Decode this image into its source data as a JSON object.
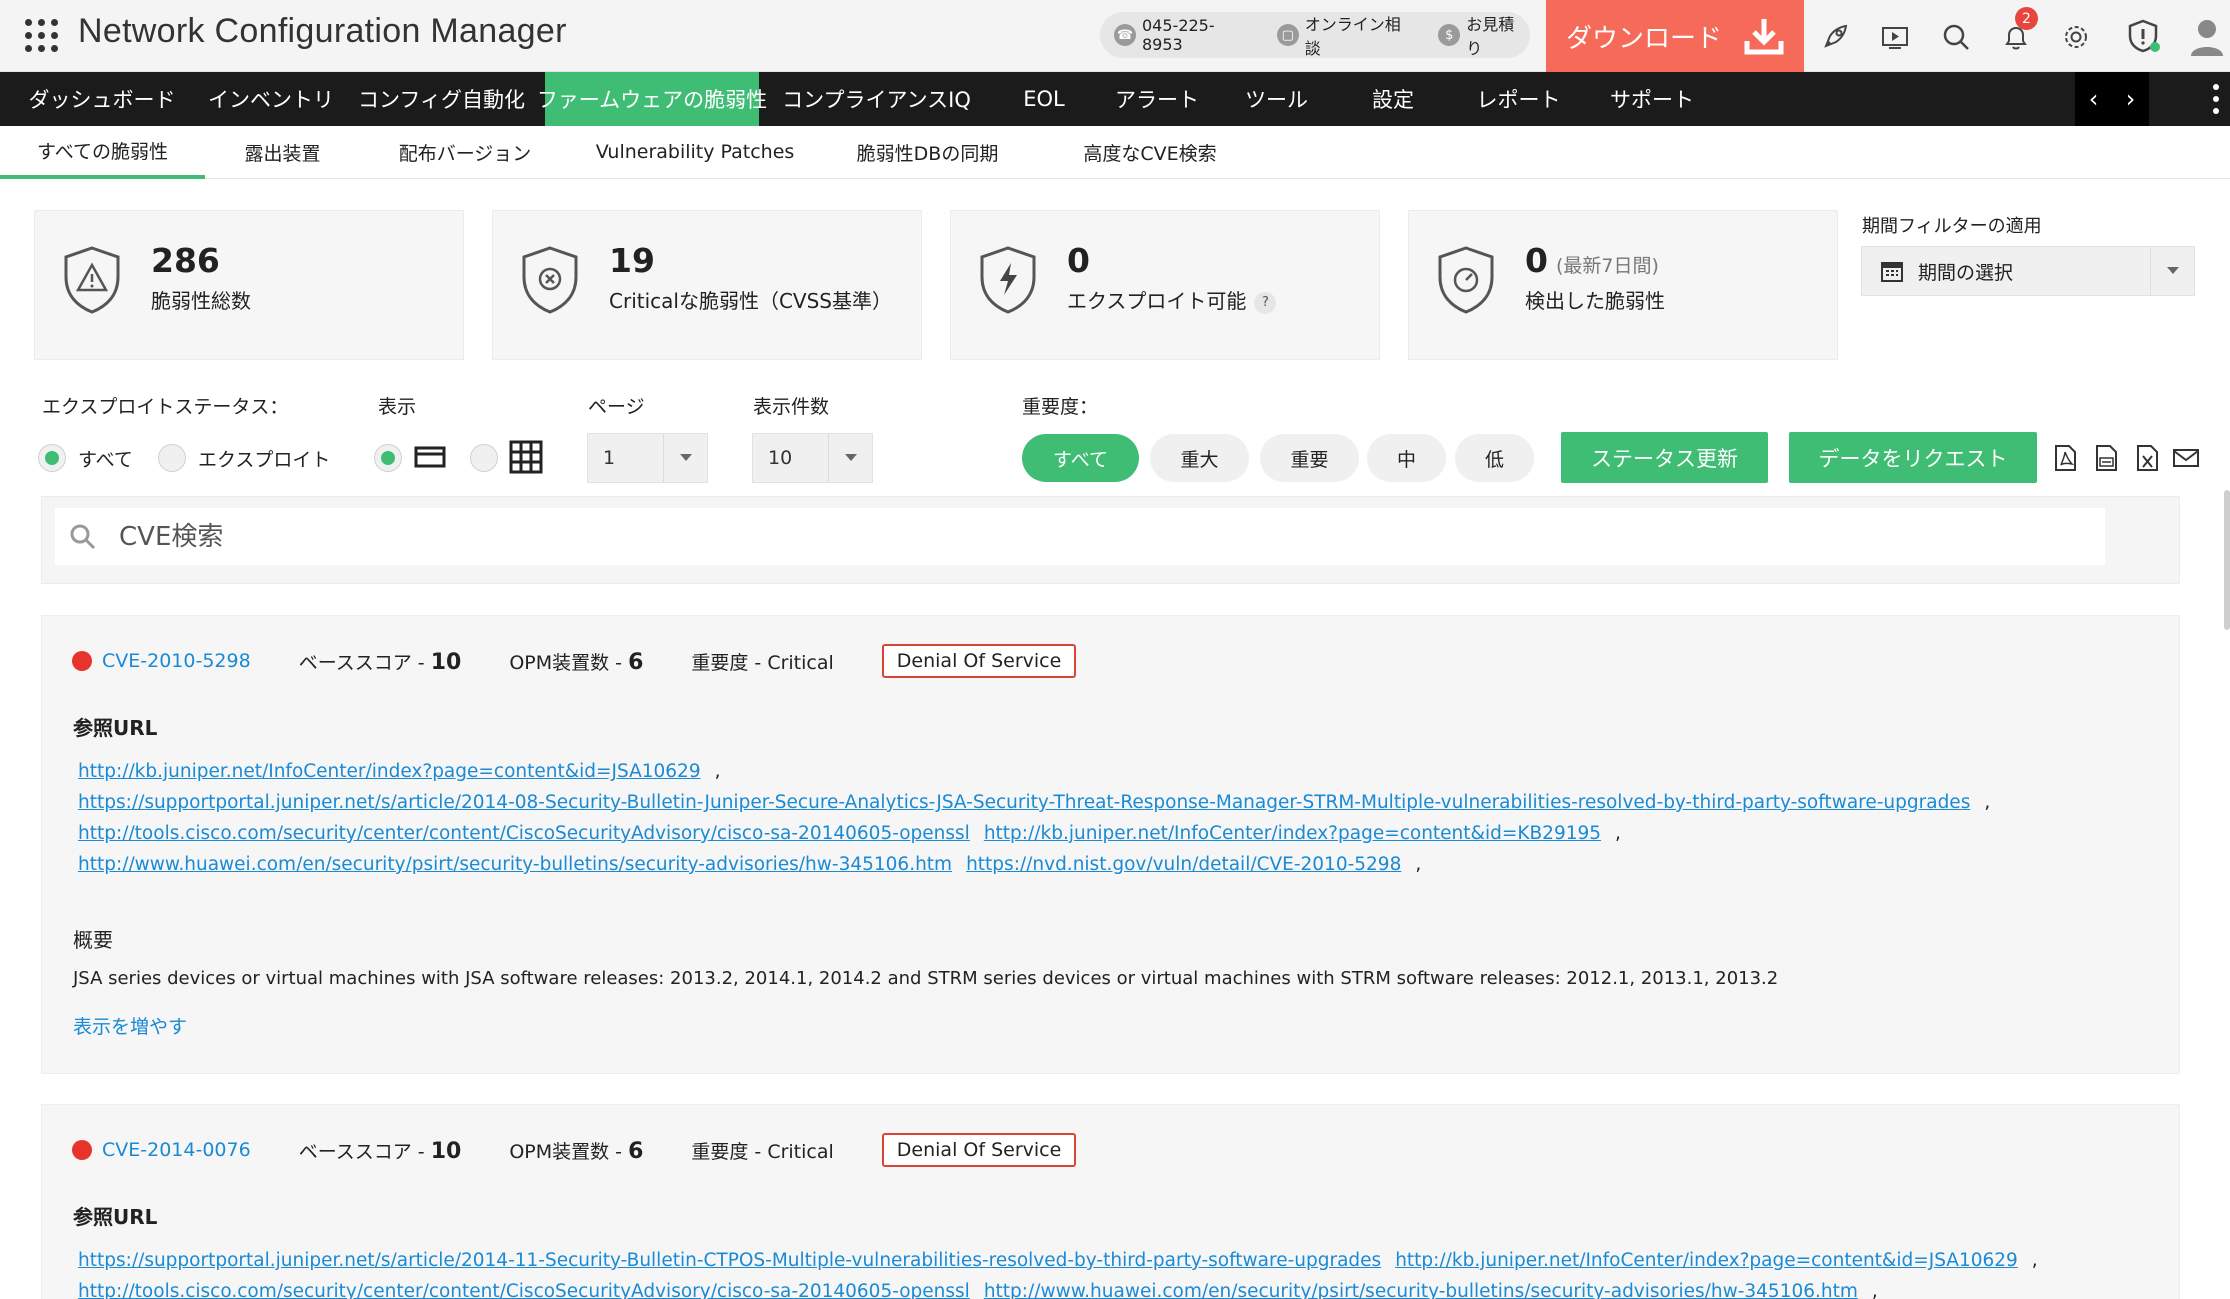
{
  "header": {
    "app_title": "Network Configuration Manager",
    "phone": "045-225-8953",
    "online_consult": "オンライン相談",
    "quote": "お見積り",
    "download_label": "ダウンロード",
    "notification_count": "2"
  },
  "nav": {
    "items": [
      {
        "label": "ダッシュボード"
      },
      {
        "label": "インベントリ"
      },
      {
        "label": "コンフィグ自動化"
      },
      {
        "label": "ファームウェアの脆弱性"
      },
      {
        "label": "コンプライアンスIQ"
      },
      {
        "label": "EOL"
      },
      {
        "label": "アラート"
      },
      {
        "label": "ツール"
      },
      {
        "label": "設定"
      },
      {
        "label": "レポート"
      },
      {
        "label": "サポート"
      }
    ],
    "active_index": 3
  },
  "subnav": {
    "tabs": [
      {
        "label": "すべての脆弱性"
      },
      {
        "label": "露出装置"
      },
      {
        "label": "配布バージョン"
      },
      {
        "label": "Vulnerability Patches"
      },
      {
        "label": "脆弱性DBの同期"
      },
      {
        "label": "高度なCVE検索"
      }
    ],
    "active_index": 0
  },
  "stats": [
    {
      "value": "286",
      "label": "脆弱性総数",
      "icon": "warning-shield-icon"
    },
    {
      "value": "19",
      "label": "Criticalな脆弱性（CVSS基準）",
      "icon": "x-shield-icon"
    },
    {
      "value": "0",
      "label": "エクスプロイト可能",
      "icon": "bolt-shield-icon"
    },
    {
      "value": "0",
      "sublabel": "(最新7日間)",
      "label": "検出した脆弱性",
      "icon": "clock-shield-icon"
    }
  ],
  "period": {
    "label": "期間フィルターの適用",
    "select": "期間の選択"
  },
  "filters": {
    "exploit_label": "エクスプロイトステータス：",
    "exploit_all": "すべて",
    "exploit_only": "エクスプロイト",
    "view_label": "表示",
    "page_label": "ページ",
    "page_value": "1",
    "count_label": "表示件数",
    "count_value": "10",
    "severity_label": "重要度：",
    "severity": [
      {
        "label": "すべて",
        "active": true
      },
      {
        "label": "重大"
      },
      {
        "label": "重要"
      },
      {
        "label": "中"
      },
      {
        "label": "低"
      }
    ],
    "status_update": "ステータス更新",
    "request_data": "データをリクエスト"
  },
  "search": {
    "placeholder": "CVE検索"
  },
  "vulnerabilities": [
    {
      "cve": "CVE-2010-5298",
      "base_score_label": "ベーススコア - ",
      "base_score": "10",
      "opm_label": "OPM装置数 - ",
      "opm_count": "6",
      "severity": "重要度 - Critical",
      "tag": "Denial Of Service",
      "ref_title": "参照URL",
      "urls": [
        "http://kb.juniper.net/InfoCenter/index?page=content&id=JSA10629",
        "https://supportportal.juniper.net/s/article/2014-08-Security-Bulletin-Juniper-Secure-Analytics-JSA-Security-Threat-Response-Manager-STRM-Multiple-vulnerabilities-resolved-by-third-party-software-upgrades",
        "http://tools.cisco.com/security/center/content/CiscoSecurityAdvisory/cisco-sa-20140605-openssl",
        "http://kb.juniper.net/InfoCenter/index?page=content&id=KB29195",
        "http://www.huawei.com/en/security/psirt/security-bulletins/security-advisories/hw-345106.htm",
        "https://nvd.nist.gov/vuln/detail/CVE-2010-5298"
      ],
      "summary_title": "概要",
      "summary": "JSA series devices or virtual machines with JSA software releases: 2013.2, 2014.1, 2014.2 and STRM series devices or virtual machines with STRM software releases: 2012.1, 2013.1, 2013.2",
      "more": "表示を増やす"
    },
    {
      "cve": "CVE-2014-0076",
      "base_score_label": "ベーススコア - ",
      "base_score": "10",
      "opm_label": "OPM装置数 - ",
      "opm_count": "6",
      "severity": "重要度 - Critical",
      "tag": "Denial Of Service",
      "ref_title": "参照URL",
      "urls": [
        "https://supportportal.juniper.net/s/article/2014-11-Security-Bulletin-CTPOS-Multiple-vulnerabilities-resolved-by-third-party-software-upgrades",
        "http://kb.juniper.net/InfoCenter/index?page=content&id=JSA10629",
        "http://tools.cisco.com/security/center/content/CiscoSecurityAdvisory/cisco-sa-20140605-openssl",
        "http://www.huawei.com/en/security/psirt/security-bulletins/security-advisories/hw-345106.htm"
      ]
    }
  ],
  "colors": {
    "accent": "#3fbd75",
    "download": "#f66a5a",
    "link": "#1a8ad4",
    "critical": "#e8332b"
  }
}
